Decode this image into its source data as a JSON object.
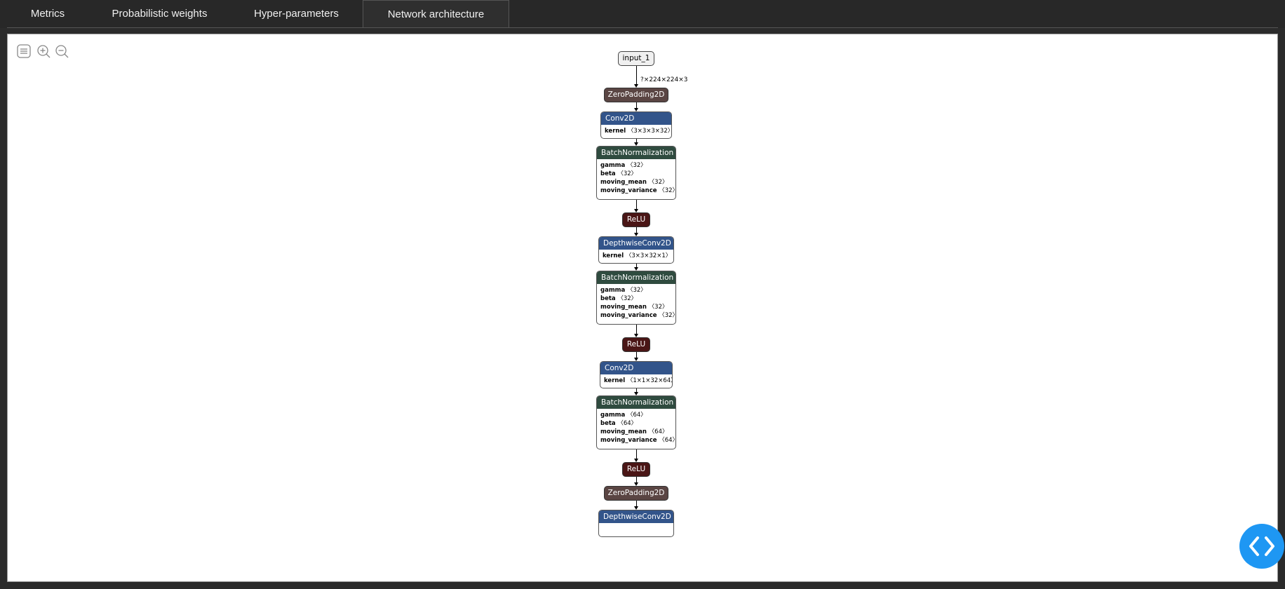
{
  "tabs": [
    {
      "label": "Metrics"
    },
    {
      "label": "Probabilistic weights"
    },
    {
      "label": "Hyper-parameters"
    },
    {
      "label": "Network architecture"
    }
  ],
  "active_tab": "Network architecture",
  "toolbar": {
    "icons": [
      "list-icon",
      "zoom-in-icon",
      "zoom-out-icon"
    ]
  },
  "graph": {
    "input_shape": "?×224×224×3",
    "nodes": [
      {
        "type": "input",
        "title": "input_1"
      },
      {
        "type": "pad",
        "title": "ZeroPadding2D"
      },
      {
        "type": "conv",
        "title": "Conv2D",
        "attrs": [
          {
            "name": "kernel",
            "value": "〈3×3×3×32〉"
          }
        ]
      },
      {
        "type": "bn",
        "title": "BatchNormalization",
        "attrs": [
          {
            "name": "gamma",
            "value": "〈32〉"
          },
          {
            "name": "beta",
            "value": "〈32〉"
          },
          {
            "name": "moving_mean",
            "value": "〈32〉"
          },
          {
            "name": "moving_variance",
            "value": "〈32〉"
          }
        ]
      },
      {
        "type": "relu",
        "title": "ReLU"
      },
      {
        "type": "conv",
        "title": "DepthwiseConv2D",
        "attrs": [
          {
            "name": "kernel",
            "value": "〈3×3×32×1〉"
          }
        ]
      },
      {
        "type": "bn",
        "title": "BatchNormalization",
        "attrs": [
          {
            "name": "gamma",
            "value": "〈32〉"
          },
          {
            "name": "beta",
            "value": "〈32〉"
          },
          {
            "name": "moving_mean",
            "value": "〈32〉"
          },
          {
            "name": "moving_variance",
            "value": "〈32〉"
          }
        ]
      },
      {
        "type": "relu",
        "title": "ReLU"
      },
      {
        "type": "conv",
        "title": "Conv2D",
        "attrs": [
          {
            "name": "kernel",
            "value": "〈1×1×32×64〉"
          }
        ]
      },
      {
        "type": "bn",
        "title": "BatchNormalization",
        "attrs": [
          {
            "name": "gamma",
            "value": "〈64〉"
          },
          {
            "name": "beta",
            "value": "〈64〉"
          },
          {
            "name": "moving_mean",
            "value": "〈64〉"
          },
          {
            "name": "moving_variance",
            "value": "〈64〉"
          }
        ]
      },
      {
        "type": "relu",
        "title": "ReLU"
      },
      {
        "type": "pad",
        "title": "ZeroPadding2D"
      },
      {
        "type": "conv",
        "title": "DepthwiseConv2D",
        "attrs": []
      }
    ]
  },
  "colors": {
    "accent": "#1e97f3",
    "conv_header": "#32548a",
    "bn_header": "#2f4b3f",
    "relu": "#4a1616",
    "pad": "#5a4543"
  },
  "nav_button": {
    "icon": "code-icon"
  }
}
